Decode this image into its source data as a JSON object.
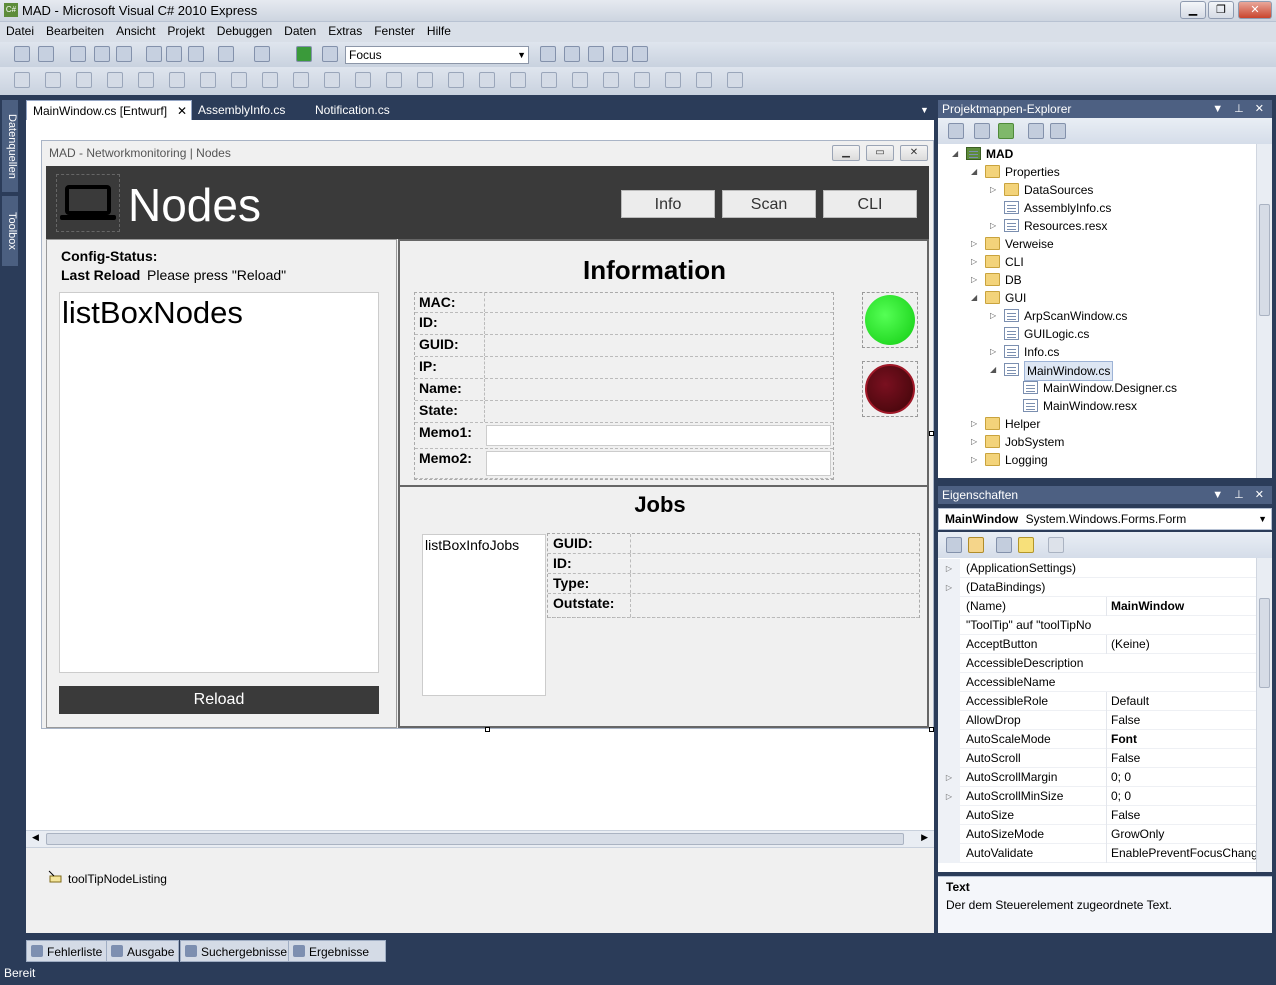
{
  "window": {
    "title": "MAD - Microsoft Visual C# 2010 Express",
    "minimize": "▁",
    "restore": "❐",
    "close": "✕"
  },
  "menu": [
    "Datei",
    "Bearbeiten",
    "Ansicht",
    "Projekt",
    "Debuggen",
    "Daten",
    "Extras",
    "Fenster",
    "Hilfe"
  ],
  "toolbar": {
    "find_combo": "Focus"
  },
  "left_strip": {
    "datenquellen": "Datenquellen",
    "toolbox": "Toolbox"
  },
  "doc_tabs": [
    {
      "label": "MainWindow.cs [Entwurf]",
      "active": true
    },
    {
      "label": "AssemblyInfo.cs",
      "active": false
    },
    {
      "label": "Notification.cs",
      "active": false
    }
  ],
  "form": {
    "title": "MAD - Networkmonitoring | Nodes",
    "header": {
      "title": "Nodes",
      "buttons": [
        "Info",
        "Scan",
        "CLI"
      ]
    },
    "left": {
      "config_status": "Config-Status:",
      "last_reload": "Last Reload",
      "reload_msg": "Please press \"Reload\"",
      "listbox": "listBoxNodes",
      "reload_button": "Reload"
    },
    "info": {
      "title": "Information",
      "rows": [
        "MAC:",
        "ID:",
        "GUID:",
        "IP:",
        "Name:",
        "State:",
        "Memo1:",
        "Memo2:"
      ]
    },
    "jobs": {
      "title": "Jobs",
      "listbox": "listBoxInfoJobs",
      "rows": [
        "GUID:",
        "ID:",
        "Type:",
        "Outstate:"
      ]
    }
  },
  "tray": {
    "component": "toolTipNodeListing"
  },
  "solution_explorer": {
    "title": "Projektmappen-Explorer",
    "items": [
      {
        "label": "MAD",
        "bold": true,
        "exp": "◢",
        "icon": "project"
      },
      {
        "label": "Properties",
        "exp": "◢",
        "icon": "folder"
      },
      {
        "label": "DataSources",
        "exp": "▷",
        "icon": "folder"
      },
      {
        "label": "AssemblyInfo.cs",
        "exp": "",
        "icon": "cs"
      },
      {
        "label": "Resources.resx",
        "exp": "▷",
        "icon": "cs"
      },
      {
        "label": "Verweise",
        "exp": "▷",
        "icon": "folder"
      },
      {
        "label": "CLI",
        "exp": "▷",
        "icon": "folder"
      },
      {
        "label": "DB",
        "exp": "▷",
        "icon": "folder"
      },
      {
        "label": "GUI",
        "exp": "◢",
        "icon": "folder"
      },
      {
        "label": "ArpScanWindow.cs",
        "exp": "▷",
        "icon": "cs"
      },
      {
        "label": "GUILogic.cs",
        "exp": "",
        "icon": "cs"
      },
      {
        "label": "Info.cs",
        "exp": "▷",
        "icon": "cs"
      },
      {
        "label": "MainWindow.cs",
        "exp": "◢",
        "icon": "cs"
      },
      {
        "label": "MainWindow.Designer.cs",
        "exp": "",
        "icon": "cs"
      },
      {
        "label": "MainWindow.resx",
        "exp": "",
        "icon": "cs"
      },
      {
        "label": "Helper",
        "exp": "▷",
        "icon": "folder"
      },
      {
        "label": "JobSystem",
        "exp": "▷",
        "icon": "folder"
      },
      {
        "label": "Logging",
        "exp": "▷",
        "icon": "folder"
      }
    ]
  },
  "properties": {
    "title": "Eigenschaften",
    "object_name": "MainWindow",
    "object_type": "System.Windows.Forms.Form",
    "rows": [
      {
        "name": "(ApplicationSettings)",
        "value": "",
        "exp": "▷"
      },
      {
        "name": "(DataBindings)",
        "value": "",
        "exp": "▷"
      },
      {
        "name": "(Name)",
        "value": "MainWindow",
        "exp": "",
        "bold": true
      },
      {
        "name": "\"ToolTip\" auf \"toolTipNo",
        "value": "",
        "exp": ""
      },
      {
        "name": "AcceptButton",
        "value": "(Keine)",
        "exp": ""
      },
      {
        "name": "AccessibleDescription",
        "value": "",
        "exp": ""
      },
      {
        "name": "AccessibleName",
        "value": "",
        "exp": ""
      },
      {
        "name": "AccessibleRole",
        "value": "Default",
        "exp": ""
      },
      {
        "name": "AllowDrop",
        "value": "False",
        "exp": ""
      },
      {
        "name": "AutoScaleMode",
        "value": "Font",
        "exp": "",
        "bold": true
      },
      {
        "name": "AutoScroll",
        "value": "False",
        "exp": ""
      },
      {
        "name": "AutoScrollMargin",
        "value": "0; 0",
        "exp": "▷"
      },
      {
        "name": "AutoScrollMinSize",
        "value": "0; 0",
        "exp": "▷"
      },
      {
        "name": "AutoSize",
        "value": "False",
        "exp": ""
      },
      {
        "name": "AutoSizeMode",
        "value": "GrowOnly",
        "exp": ""
      },
      {
        "name": "AutoValidate",
        "value": "EnablePreventFocusChange",
        "exp": ""
      }
    ],
    "desc_title": "Text",
    "desc_text": "Der dem Steuerelement zugeordnete Text."
  },
  "bottom_tabs": [
    "Fehlerliste",
    "Ausgabe",
    "Suchergebnisse",
    "Ergebnisse der Symbolsuche"
  ],
  "status": "Bereit",
  "colors": {
    "led_on": "#22dd22",
    "led_off": "#5a0a12",
    "header_dark": "#3a3a3a"
  }
}
